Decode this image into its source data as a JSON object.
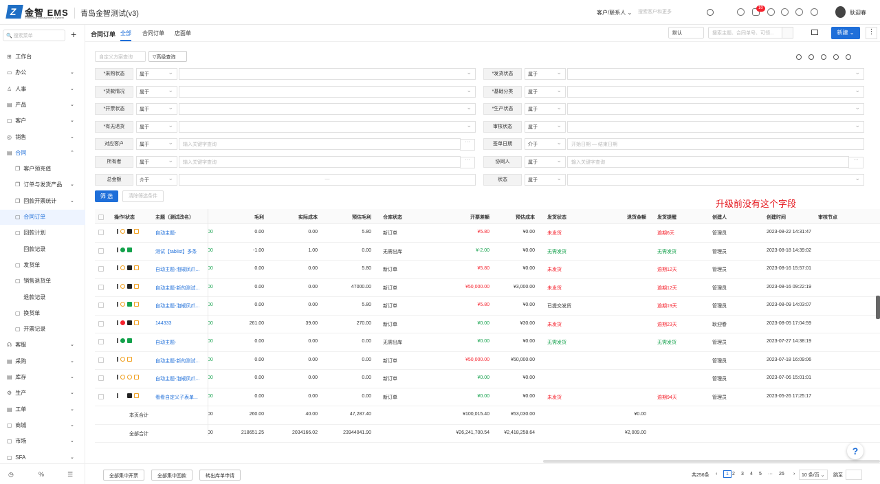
{
  "header": {
    "logo_text": "金智 EMS",
    "logo_sub": "Enterprise Management System",
    "system_title": "青岛金智测试(v3)",
    "customer_menu": "客户/联系人",
    "search_placeholder": "搜索客户和更多",
    "notif_count": "10",
    "user_name": "耿迎春"
  },
  "sidebar": {
    "search_placeholder": "搜索菜单",
    "plus": "+",
    "items": [
      {
        "label": "工作台",
        "icon": "⊞",
        "chev": ""
      },
      {
        "label": "办公",
        "icon": "▭",
        "chev": "⌄"
      },
      {
        "label": "人事",
        "icon": "♙",
        "chev": "⌄"
      },
      {
        "label": "产品",
        "icon": "▤",
        "chev": "⌄"
      },
      {
        "label": "客户",
        "icon": "▢",
        "chev": "⌄"
      },
      {
        "label": "销售",
        "icon": "◎",
        "chev": "⌄"
      },
      {
        "label": "合同",
        "icon": "▤",
        "chev": "⌃"
      },
      {
        "label": "客户预充值",
        "icon": "❐",
        "chev": ""
      },
      {
        "label": "订单与发货产品",
        "icon": "❐",
        "chev": "⌄"
      },
      {
        "label": "回款开票统计",
        "icon": "❐",
        "chev": "⌄"
      },
      {
        "label": "合同订单",
        "icon": "▢",
        "chev": ""
      },
      {
        "label": "回款计划",
        "icon": "▢",
        "chev": ""
      },
      {
        "label": "回款记录",
        "icon": "",
        "chev": ""
      },
      {
        "label": "发货单",
        "icon": "▢",
        "chev": ""
      },
      {
        "label": "销售退货单",
        "icon": "▢",
        "chev": ""
      },
      {
        "label": "退款记录",
        "icon": "",
        "chev": ""
      },
      {
        "label": "换货单",
        "icon": "▢",
        "chev": ""
      },
      {
        "label": "开票记录",
        "icon": "▢",
        "chev": ""
      },
      {
        "label": "客服",
        "icon": "☊",
        "chev": "⌄"
      },
      {
        "label": "采购",
        "icon": "▤",
        "chev": "⌄"
      },
      {
        "label": "库存",
        "icon": "▤",
        "chev": "⌄"
      },
      {
        "label": "生产",
        "icon": "⚙",
        "chev": "⌄"
      },
      {
        "label": "工单",
        "icon": "▤",
        "chev": "⌄"
      },
      {
        "label": "商城",
        "icon": "▢",
        "chev": "⌄"
      },
      {
        "label": "市场",
        "icon": "▢",
        "chev": "⌄"
      },
      {
        "label": "SFA",
        "icon": "▢",
        "chev": "⌄"
      }
    ],
    "footer": [
      "◷",
      "%",
      "☰"
    ]
  },
  "tabbar": {
    "title": "合同订单",
    "tabs": [
      "全部",
      "合同订单",
      "店面单"
    ],
    "view_select": "默认",
    "search_placeholder": "搜索主题、合同单号、可领...",
    "new_button": "新建 ⌄",
    "more": "⋮"
  },
  "filters": {
    "scheme_placeholder": "自定义方案查询",
    "advanced": "高级查询",
    "left": [
      {
        "label": "*采购状态",
        "op": "属于",
        "val": "",
        "type": "dd"
      },
      {
        "label": "*货款情况",
        "op": "属于",
        "val": "",
        "type": "dd"
      },
      {
        "label": "*开票状态",
        "op": "属于",
        "val": "",
        "type": "dd"
      },
      {
        "label": "*有无退货",
        "op": "属于",
        "val": "",
        "type": "dd"
      },
      {
        "label": "对应客户",
        "op": "属于",
        "val": "输入关键字查询",
        "type": "dots"
      },
      {
        "label": "所有者",
        "op": "属于",
        "val": "输入关键字查询",
        "type": "dots"
      },
      {
        "label": "总金额",
        "op": "介于",
        "val": "—",
        "type": "range"
      }
    ],
    "right": [
      {
        "label": "*发货状态",
        "op": "属于",
        "val": "",
        "type": "dd"
      },
      {
        "label": "*基础分类",
        "op": "属于",
        "val": "",
        "type": "dd"
      },
      {
        "label": "*生产状态",
        "op": "属于",
        "val": "",
        "type": "dd"
      },
      {
        "label": "审核状态",
        "op": "属于",
        "val": "",
        "type": "dd"
      },
      {
        "label": "签单日期",
        "op": "介于",
        "val": "开始日期                                    —  结束日期",
        "type": "date"
      },
      {
        "label": "协同人",
        "op": "属于",
        "val": "输入关键字查询",
        "type": "dots"
      },
      {
        "label": "状态",
        "op": "属于",
        "val": "",
        "type": "dd"
      }
    ],
    "filter_button": "筛 选",
    "clear_button": "清除筛选条件"
  },
  "annotation": "升级前没有这个字段",
  "table": {
    "headers": [
      "操作/状态",
      "主题（测试改名）",
      "",
      "毛利",
      "实际成本",
      "预估毛利",
      "仓库状态",
      "开票差额",
      "预估成本",
      "发货状态",
      "退货金额",
      "发货提醒",
      "创建人",
      "创建时间",
      "审核节点"
    ],
    "rows": [
      {
        "subject": "自动主题-",
        "a": "00",
        "profit": "0.00",
        "cost": "0.00",
        "est": "5.80",
        "wh": "新订单",
        "diff": "¥5.80",
        "diffc": "red",
        "ecost": "¥0.00",
        "ship": "未发货",
        "shipc": "red",
        "ret": "",
        "remind": "逾期6天",
        "remc": "red",
        "creator": "管理员",
        "time": "2023-08-22 14:31:47",
        "icons": "d o b y"
      },
      {
        "subject": "测试【tablist】多条",
        "a": "00",
        "profit": "-1.00",
        "cost": "1.00",
        "est": "0.00",
        "wh": "无需出库",
        "diff": "¥-2.00",
        "diffc": "green",
        "ecost": "¥0.00",
        "ship": "无需发货",
        "shipc": "green",
        "ret": "",
        "remind": "无需发货",
        "remc": "green",
        "creator": "管理员",
        "time": "2023-08-18 14:39:02",
        "icons": "d g gg"
      },
      {
        "subject": "自动主题-泡椒凤爪...",
        "a": "00",
        "profit": "0.00",
        "cost": "0.00",
        "est": "5.80",
        "wh": "新订单",
        "diff": "¥5.80",
        "diffc": "red",
        "ecost": "¥0.00",
        "ship": "未发货",
        "shipc": "red",
        "ret": "",
        "remind": "逾期12天",
        "remc": "red",
        "creator": "管理员",
        "time": "2023-08-16 15:57:01",
        "icons": "d o b y"
      },
      {
        "subject": "自动主题-新的测试...",
        "a": "00",
        "profit": "0.00",
        "cost": "0.00",
        "est": "47000.00",
        "wh": "新订单",
        "diff": "¥50,000.00",
        "diffc": "red",
        "ecost": "¥3,000.00",
        "ship": "未发货",
        "shipc": "red",
        "ret": "",
        "remind": "逾期12天",
        "remc": "red",
        "creator": "管理员",
        "time": "2023-08-16 09:22:19",
        "icons": "d o b y"
      },
      {
        "subject": "自动主题-泡椒凤爪...",
        "a": "00",
        "profit": "0.00",
        "cost": "0.00",
        "est": "5.80",
        "wh": "新订单",
        "diff": "¥5.80",
        "diffc": "red",
        "ecost": "¥0.00",
        "ship": "已提交发货",
        "shipc": "",
        "ret": "",
        "remind": "逾期19天",
        "remc": "red",
        "creator": "管理员",
        "time": "2023-08-09 14:03:07",
        "icons": "d o gg y"
      },
      {
        "subject": "144333",
        "a": "00",
        "profit": "261.00",
        "cost": "39.00",
        "est": "270.00",
        "wh": "新订单",
        "diff": "¥0.00",
        "diffc": "green",
        "ecost": "¥30.00",
        "ship": "未发货",
        "shipc": "red",
        "ret": "",
        "remind": "逾期23天",
        "remc": "red",
        "creator": "耿迎春",
        "time": "2023-08-05 17:04:59",
        "icons": "d x b y"
      },
      {
        "subject": "自动主题-",
        "a": "00",
        "profit": "0.00",
        "cost": "0.00",
        "est": "0.00",
        "wh": "无需出库",
        "diff": "¥0.00",
        "diffc": "green",
        "ecost": "¥0.00",
        "ship": "无需发货",
        "shipc": "green",
        "ret": "",
        "remind": "无需发货",
        "remc": "green",
        "creator": "管理员",
        "time": "2023-07-27 14:38:19",
        "icons": "d g gg"
      },
      {
        "subject": "自动主题-新的测试...",
        "a": "00",
        "profit": "0.00",
        "cost": "0.00",
        "est": "0.00",
        "wh": "新订单",
        "diff": "¥50,000.00",
        "diffc": "red",
        "ecost": "¥50,000.00",
        "ship": "",
        "shipc": "",
        "ret": "",
        "remind": "",
        "remc": "",
        "creator": "管理员",
        "time": "2023-07-18 16:09:06",
        "icons": "d o y"
      },
      {
        "subject": "自动主题-泡椒凤爪...",
        "a": "00",
        "profit": "0.00",
        "cost": "0.00",
        "est": "0.00",
        "wh": "新订单",
        "diff": "¥0.00",
        "diffc": "green",
        "ecost": "¥0.00",
        "ship": "",
        "shipc": "",
        "ret": "",
        "remind": "",
        "remc": "",
        "creator": "管理员",
        "time": "2023-07-06 15:01:01",
        "icons": "d o o y"
      },
      {
        "subject": "看看自定义子表单...",
        "a": "00",
        "profit": "0.00",
        "cost": "0.00",
        "est": "0.00",
        "wh": "新订单",
        "diff": "¥0.00",
        "diffc": "green",
        "ecost": "¥0.00",
        "ship": "未发货",
        "shipc": "red",
        "ret": "",
        "remind": "逾期94天",
        "remc": "red",
        "creator": "管理员",
        "time": "2023-05-26 17:25:17",
        "icons": "d p b y"
      }
    ],
    "totals": [
      {
        "label": "本页合计",
        "a": "00",
        "profit": "260.00",
        "cost": "40.00",
        "est": "47,287.40",
        "diff": "¥100,015.40",
        "ecost": "¥53,030.00",
        "ret": "¥0.00"
      },
      {
        "label": "全部合计",
        "a": "00",
        "profit": "218651.25",
        "cost": "2034166.02",
        "est": "23944041.90",
        "diff": "¥26,241,700.54",
        "ecost": "¥2,418,258.64",
        "ret": "¥2,009.00"
      }
    ]
  },
  "footer": {
    "buttons": [
      "全部集中开票",
      "全部集中回款",
      "转出库单申请"
    ],
    "total": "共256条",
    "prev": "‹",
    "pages": [
      "1",
      "2",
      "3",
      "4",
      "5",
      "···",
      "26"
    ],
    "next": "›",
    "page_size": "10 条/页 ⌄",
    "goto": "跳至"
  },
  "help": "?"
}
